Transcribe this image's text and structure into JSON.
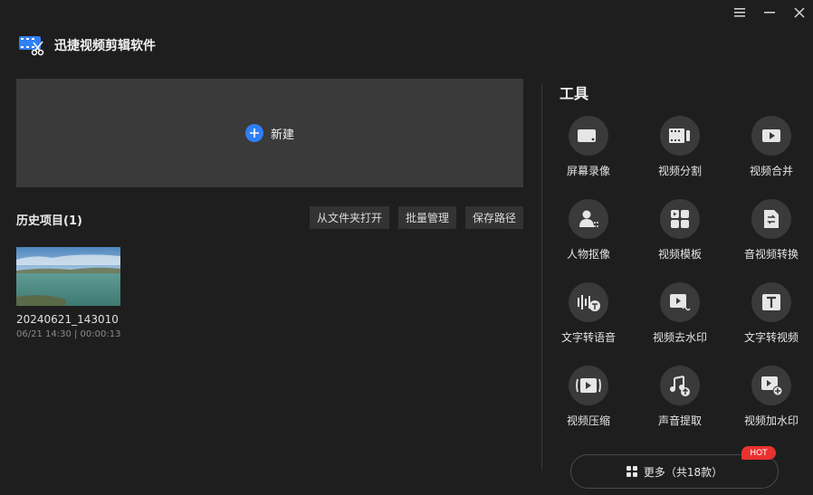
{
  "window": {
    "menu_icon": "hamburger-icon",
    "minimize_icon": "minimize-icon",
    "close_icon": "close-icon"
  },
  "app": {
    "title": "迅捷视频剪辑软件",
    "logo_icon": "film-scissors-icon"
  },
  "new_project": {
    "label": "新建",
    "icon": "plus-circle-icon",
    "accent": "#2f7ff5"
  },
  "history": {
    "title": "历史项目(1)",
    "buttons": [
      "从文件夹打开",
      "批量管理",
      "保存路径"
    ],
    "projects": [
      {
        "name": "20240621_143010",
        "meta": "06/21 14:30 | 00:00:13"
      }
    ]
  },
  "tools": {
    "title": "工具",
    "items": [
      {
        "label": "屏幕录像",
        "icon": "camera-icon"
      },
      {
        "label": "视频分割",
        "icon": "film-split-icon"
      },
      {
        "label": "视频合并",
        "icon": "video-merge-icon"
      },
      {
        "label": "人物抠像",
        "icon": "person-cutout-icon"
      },
      {
        "label": "视频模板",
        "icon": "template-icon"
      },
      {
        "label": "音视频转换",
        "icon": "convert-icon"
      },
      {
        "label": "文字转语音",
        "icon": "text-to-speech-icon"
      },
      {
        "label": "视频去水印",
        "icon": "remove-watermark-icon"
      },
      {
        "label": "文字转视频",
        "icon": "text-to-video-icon"
      },
      {
        "label": "视频压缩",
        "icon": "compress-icon"
      },
      {
        "label": "声音提取",
        "icon": "audio-extract-icon"
      },
      {
        "label": "视频加水印",
        "icon": "add-watermark-icon"
      }
    ],
    "more_label": "更多（共18款）",
    "more_icon": "grid-icon",
    "hot_badge": "HOT",
    "hot_color": "#e8322f"
  }
}
